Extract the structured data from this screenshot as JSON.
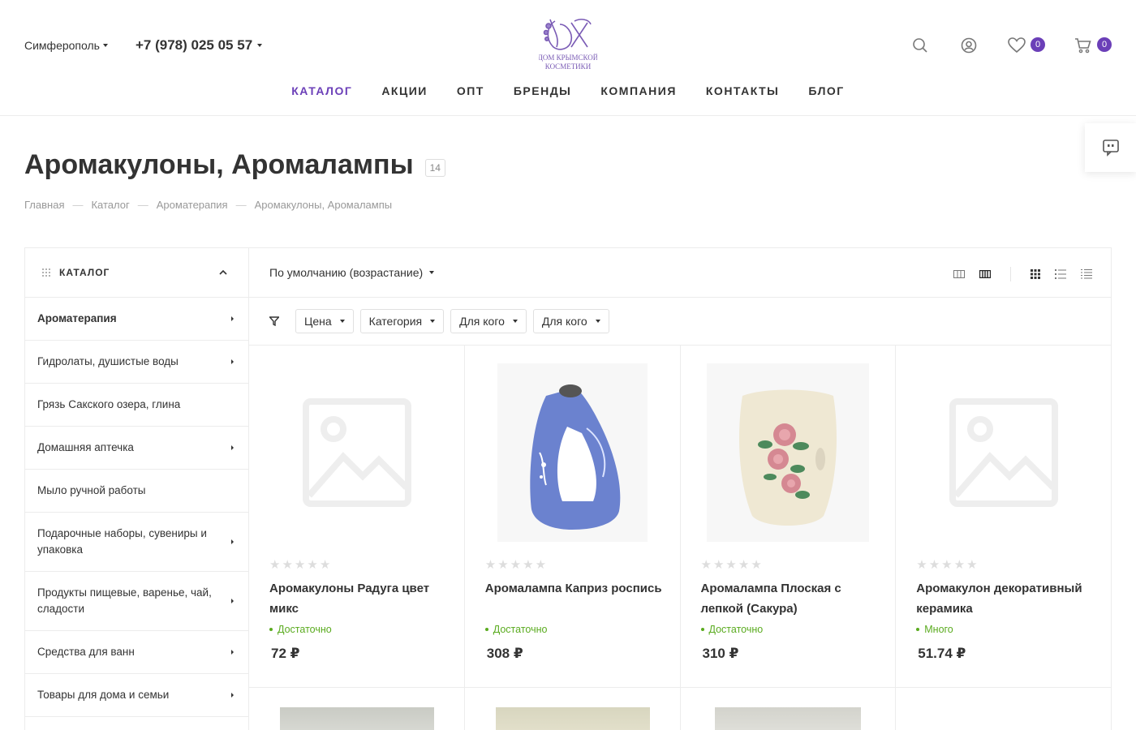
{
  "header": {
    "city": "Симферополь",
    "phone": "+7 (978) 025 05 57",
    "logo_text_line1": "ДОМ КРЫМСКОЙ",
    "logo_text_line2": "КОСМЕТИКИ",
    "favorites_count": "0",
    "cart_count": "0"
  },
  "nav": [
    "КАТАЛОГ",
    "АКЦИИ",
    "ОПТ",
    "БРЕНДЫ",
    "КОМПАНИЯ",
    "КОНТАКТЫ",
    "БЛОГ"
  ],
  "page": {
    "title": "Аромакулоны, Аромалампы",
    "count": "14"
  },
  "breadcrumb": [
    "Главная",
    "Каталог",
    "Ароматерапия",
    "Аромакулоны, Аромалампы"
  ],
  "sidebar": {
    "header": "КАТАЛОГ",
    "items": [
      {
        "label": "Ароматерапия"
      },
      {
        "label": "Гидролаты, душистые воды"
      },
      {
        "label": "Грязь Сакского озера, глина"
      },
      {
        "label": "Домашняя аптечка"
      },
      {
        "label": "Мыло ручной работы"
      },
      {
        "label": "Подарочные наборы, сувениры и упаковка"
      },
      {
        "label": "Продукты пищевые, варенье, чай, сладости"
      },
      {
        "label": "Средства для ванн"
      },
      {
        "label": "Товары для дома и семьи"
      }
    ]
  },
  "sort": {
    "label": "По умолчанию (возрастание)"
  },
  "filters": [
    "Цена",
    "Категория",
    "Для кого",
    "Для кого"
  ],
  "products": [
    {
      "title": "Аромакулоны Радуга цвет микс",
      "stock": "Достаточно",
      "price": "72 ₽"
    },
    {
      "title": "Аромалампа Каприз роспись",
      "stock": "Достаточно",
      "price": "308 ₽"
    },
    {
      "title": "Аромалампа Плоская с лепкой (Сакура)",
      "stock": "Достаточно",
      "price": "310 ₽"
    },
    {
      "title": "Аромакулон декоративный керамика",
      "stock": "Много",
      "price": "51.74 ₽"
    }
  ],
  "colors": {
    "accent": "#6b3fb8",
    "stock": "#5aab1f"
  }
}
